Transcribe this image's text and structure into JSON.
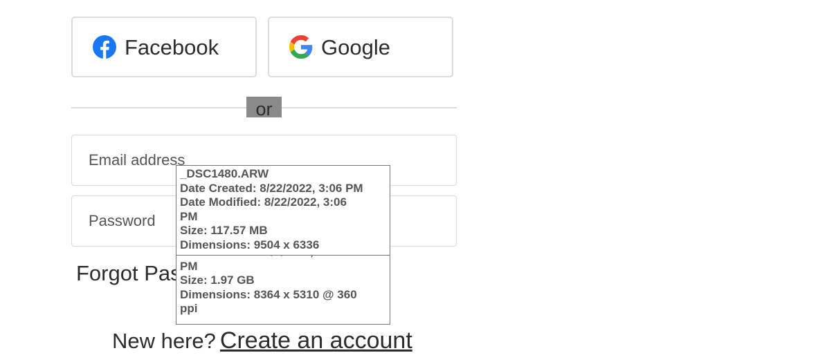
{
  "social": {
    "facebook_label": "Facebook",
    "google_label": "Google",
    "facebook_color": "#1877F2",
    "google_colors": [
      "#4285F4",
      "#34A853",
      "#FBBC05",
      "#EA4335"
    ]
  },
  "divider": {
    "text": "or"
  },
  "form": {
    "email_placeholder": "Email address",
    "password_placeholder": "Password",
    "forgot_text": "Forgot Pas"
  },
  "signup": {
    "prompt": "New here?",
    "link_text": "Create an account"
  },
  "tooltip_front": {
    "filename": "_DSC1480.ARW",
    "date_created": "Date Created: 8/22/2022, 3:06 PM",
    "date_modified_line1": "Date Modified: 8/22/2022, 3:06",
    "date_modified_line2": "PM",
    "size": "Size: 117.57 MB",
    "dimensions": "Dimensions: 9504 x 6336"
  },
  "tooltip_back": {
    "date_modified_line1": "Date Modified: 9/5/2022, 10:39",
    "date_modified_line2": "PM",
    "size": "Size: 1.97 GB",
    "dimensions_line1": "Dimensions: 8364 x 5310 @ 360",
    "dimensions_line2": "ppi"
  }
}
